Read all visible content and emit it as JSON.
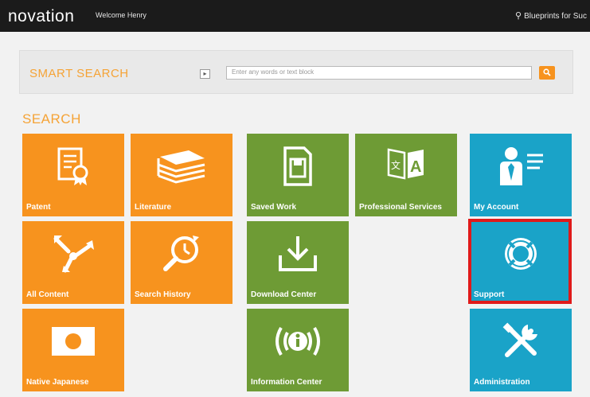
{
  "header": {
    "brand": "novation",
    "welcome": "Welcome Henry",
    "blueprints_link": "Blueprints for Suc"
  },
  "smart_search": {
    "title": "SMART SEARCH",
    "placeholder": "Enter any words or text block",
    "go_icon": "search-icon"
  },
  "section_title": "SEARCH",
  "tiles": [
    {
      "label": "Patent",
      "icon": "certificate-icon",
      "color": "#f7931e"
    },
    {
      "label": "Literature",
      "icon": "books-stack-icon",
      "color": "#f7931e"
    },
    {
      "label": "Saved Work",
      "icon": "floppy-document-icon",
      "color": "#6e9b35"
    },
    {
      "label": "Professional Services",
      "icon": "translate-book-icon",
      "color": "#6e9b35"
    },
    {
      "label": "My Account",
      "icon": "user-profile-icon",
      "color": "#1aa3c8"
    },
    {
      "label": "All Content",
      "icon": "merge-arrows-icon",
      "color": "#f7931e"
    },
    {
      "label": "Search History",
      "icon": "search-history-icon",
      "color": "#f7931e"
    },
    {
      "label": "Download Center",
      "icon": "download-icon",
      "color": "#6e9b35"
    },
    {
      "label": "Support",
      "icon": "lifebuoy-icon",
      "color": "#1aa3c8"
    },
    {
      "label": "Native Japanese",
      "icon": "japan-flag-icon",
      "color": "#f7931e"
    },
    {
      "label": "Information Center",
      "icon": "info-broadcast-icon",
      "color": "#6e9b35"
    },
    {
      "label": "Administration",
      "icon": "tools-icon",
      "color": "#1aa3c8"
    }
  ]
}
